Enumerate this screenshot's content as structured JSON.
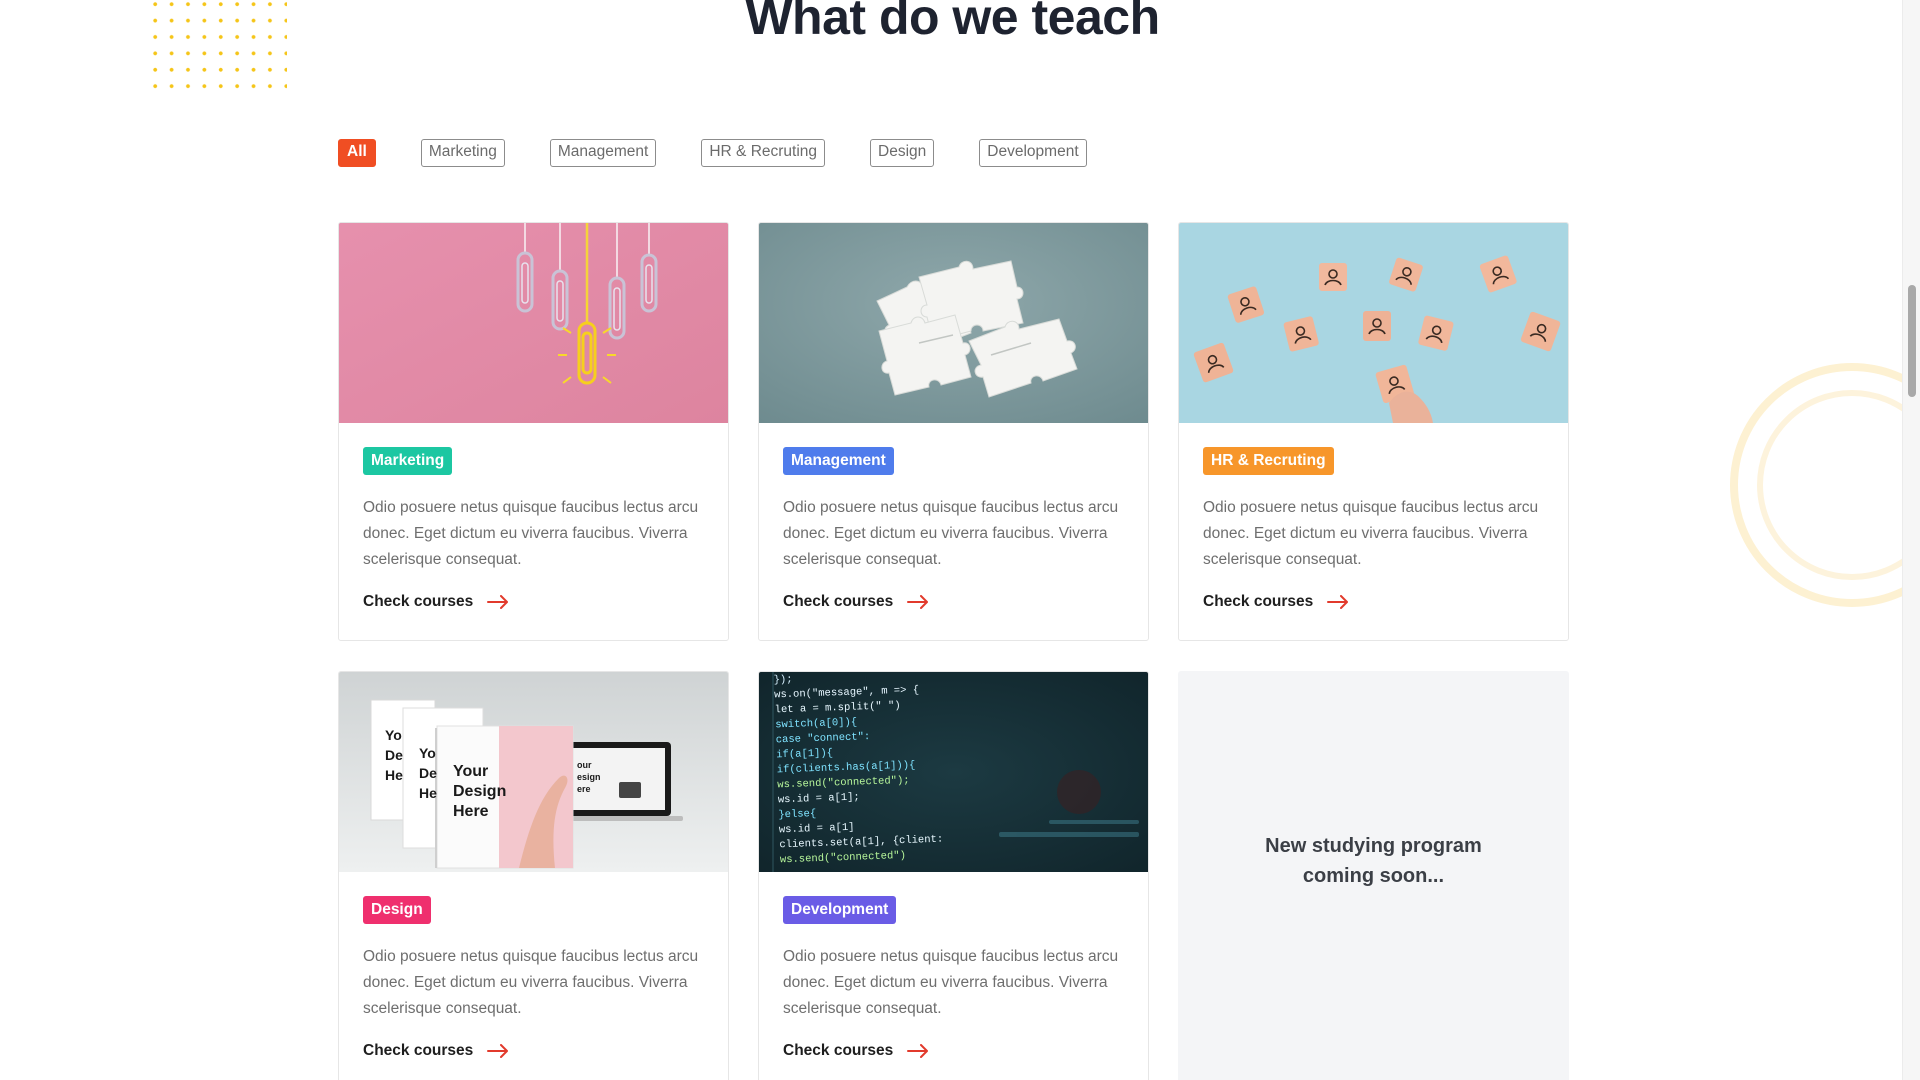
{
  "section": {
    "title": "What do we teach"
  },
  "filters": [
    {
      "label": "All",
      "active": true
    },
    {
      "label": "Marketing",
      "active": false
    },
    {
      "label": "Management",
      "active": false
    },
    {
      "label": "HR & Recruting",
      "active": false
    },
    {
      "label": "Design",
      "active": false
    },
    {
      "label": "Development",
      "active": false
    }
  ],
  "colors": {
    "accent": "#f04e23",
    "marketing": "#1cc7a2",
    "management": "#4f7cec",
    "hr": "#f7962a",
    "design": "#ef2f6e",
    "development": "#6a5ce6",
    "link_arrow": "#e23a2c",
    "dots": "#f5c518"
  },
  "cards": [
    {
      "tag": "Marketing",
      "image": "lightbulb-paperclips-image",
      "description": "Odio posuere netus quisque faucibus lectus arcu donec. Eget dictum eu viverra faucibus. Viverra scelerisque consequat.",
      "link": "Check courses"
    },
    {
      "tag": "Management",
      "image": "puzzle-pieces-image",
      "description": "Odio posuere netus quisque faucibus lectus arcu donec. Eget dictum eu viverra faucibus. Viverra scelerisque consequat.",
      "link": "Check courses"
    },
    {
      "tag": "HR & Recruting",
      "image": "people-blocks-image",
      "description": "Odio posuere netus quisque faucibus lectus arcu donec. Eget dictum eu viverra faucibus. Viverra scelerisque consequat.",
      "link": "Check courses"
    },
    {
      "tag": "Design",
      "image": "design-mockups-image",
      "description": "Odio posuere netus quisque faucibus lectus arcu donec. Eget dictum eu viverra faucibus. Viverra scelerisque consequat.",
      "link": "Check courses",
      "image_text": {
        "big": [
          "Your",
          "Design",
          "Here"
        ],
        "small": [
          "Yo",
          "De",
          "He"
        ],
        "side": [
          "our",
          "esign",
          "ere"
        ]
      }
    },
    {
      "tag": "Development",
      "image": "code-screen-image",
      "description": "Odio posuere netus quisque faucibus lectus arcu donec. Eget dictum eu viverra faucibus. Viverra scelerisque consequat.",
      "link": "Check courses",
      "code_lines": [
        "});",
        "ws.on(\"message\", m => {",
        "  let a = m.split(\" \")",
        "  switch(a[0]){",
        "    case \"connect\":",
        "      if(a[1]){",
        "        if(clients.has(a[1])){",
        "          ws.send(\"connected\");",
        "          ws.id = a[1];",
        "        }else{",
        "          ws.id = a[1]",
        "          clients.set(a[1], {client:",
        "          ws.send(\"connected\")"
      ]
    }
  ],
  "coming_soon": {
    "line1": "New studying program",
    "line2": "coming soon..."
  }
}
